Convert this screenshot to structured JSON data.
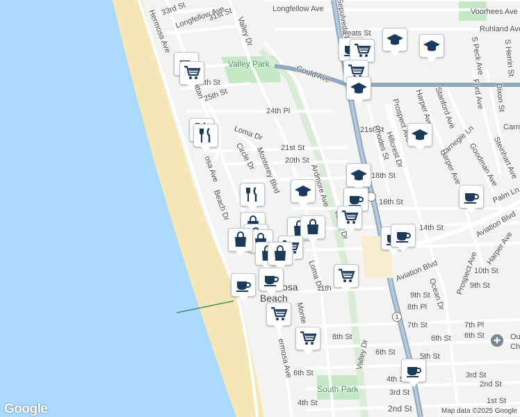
{
  "map": {
    "colors": {
      "water": "#aadaff",
      "land": "#f3f3f1",
      "beach": "#f5e7b6",
      "park": "#c5e8c5",
      "road": "#ffffff",
      "highway": "#8fa8c0",
      "pin_icon": "#1b3a5b"
    },
    "labels": {
      "longfellow": "Longfellow Ave",
      "voorhees": "Voorhees Ave",
      "ruhland": "Ruhland Ave",
      "st33": "33rd St",
      "longfellow2": "Longfellow Ave",
      "st31": "31st St",
      "hermosa_ave_n": "Hermosa Ave",
      "keats": "Keats St",
      "valley_dr_n": "Valley Dr",
      "valley_park": "Valley Park",
      "gould": "Gould Ave",
      "sepulveda": "Sepulveda Blvd",
      "st26": "26th St",
      "st25": "25th St",
      "manhattan": "Manhattan",
      "pl24": "24th Pl",
      "st21": "21st St",
      "st21b": "21st St",
      "loma_dr_n": "Loma Dr",
      "circle_dr": "Circle Dr",
      "monterey": "Monterey Blvd",
      "st20": "20th St",
      "ardmore": "Ardmore Ave",
      "hermosa_ave_mid": "osa Ave",
      "beach_dr": "Beach Dr",
      "valley_dr_mid": "Valley Dr",
      "st18": "18th St",
      "hillcrest": "Hillcrest Dr",
      "rhodes": "Rhodes St",
      "prospect_n": "Prospect Ave",
      "harper_n": "Harper Ave",
      "stanford": "Stanford Ave",
      "ford": "Ford Ave",
      "dixon": "Dixon St",
      "carnegie": "Carnegie Ln",
      "goodman": "Goodman Ave",
      "steinhart": "Steinhart Ave",
      "palm": "Palm Ln",
      "harper2": "Harper Ave",
      "st16": "16th St",
      "st14": "14th St",
      "aviation_e": "Aviation Blvd",
      "harper_se": "Harper Ave",
      "aviation": "Aviation Blvd",
      "st10": "10th St",
      "st9": "9th St",
      "st9b": "9th St",
      "pl8": "8th Pl",
      "ocean": "Ocean Dr",
      "prospect_s": "Prospect Ave",
      "st11": "11th",
      "loma_dr_s": "Loma Dr",
      "hermosa_beach_1": "osa",
      "hermosa_beach_2": "Beach",
      "monterey_s": "Monte",
      "st7": "7th St",
      "pl7": "7th Pl",
      "st8": "8th St",
      "st6": "6th St",
      "st6b": "6th St",
      "st6c": "6th St",
      "st5": "5th St",
      "st4": "4th St",
      "st4b": "4th St",
      "st3": "3rd St",
      "st3b": "3rd St",
      "st2": "2nd St",
      "st2b": "2nd St",
      "st1": "1st St",
      "hermosa_ave_s": "ermosa Ave",
      "valley_dr_s": "Valley Dr",
      "south_park": "South Park",
      "church": "Ou",
      "church2": "Ch",
      "peck": "S Peck Ave",
      "herrin": "S Herrin St",
      "carnegie_r": "Carne",
      "route_1": "1"
    },
    "google": "Google",
    "attribution": "Map data ©2025 Google"
  }
}
